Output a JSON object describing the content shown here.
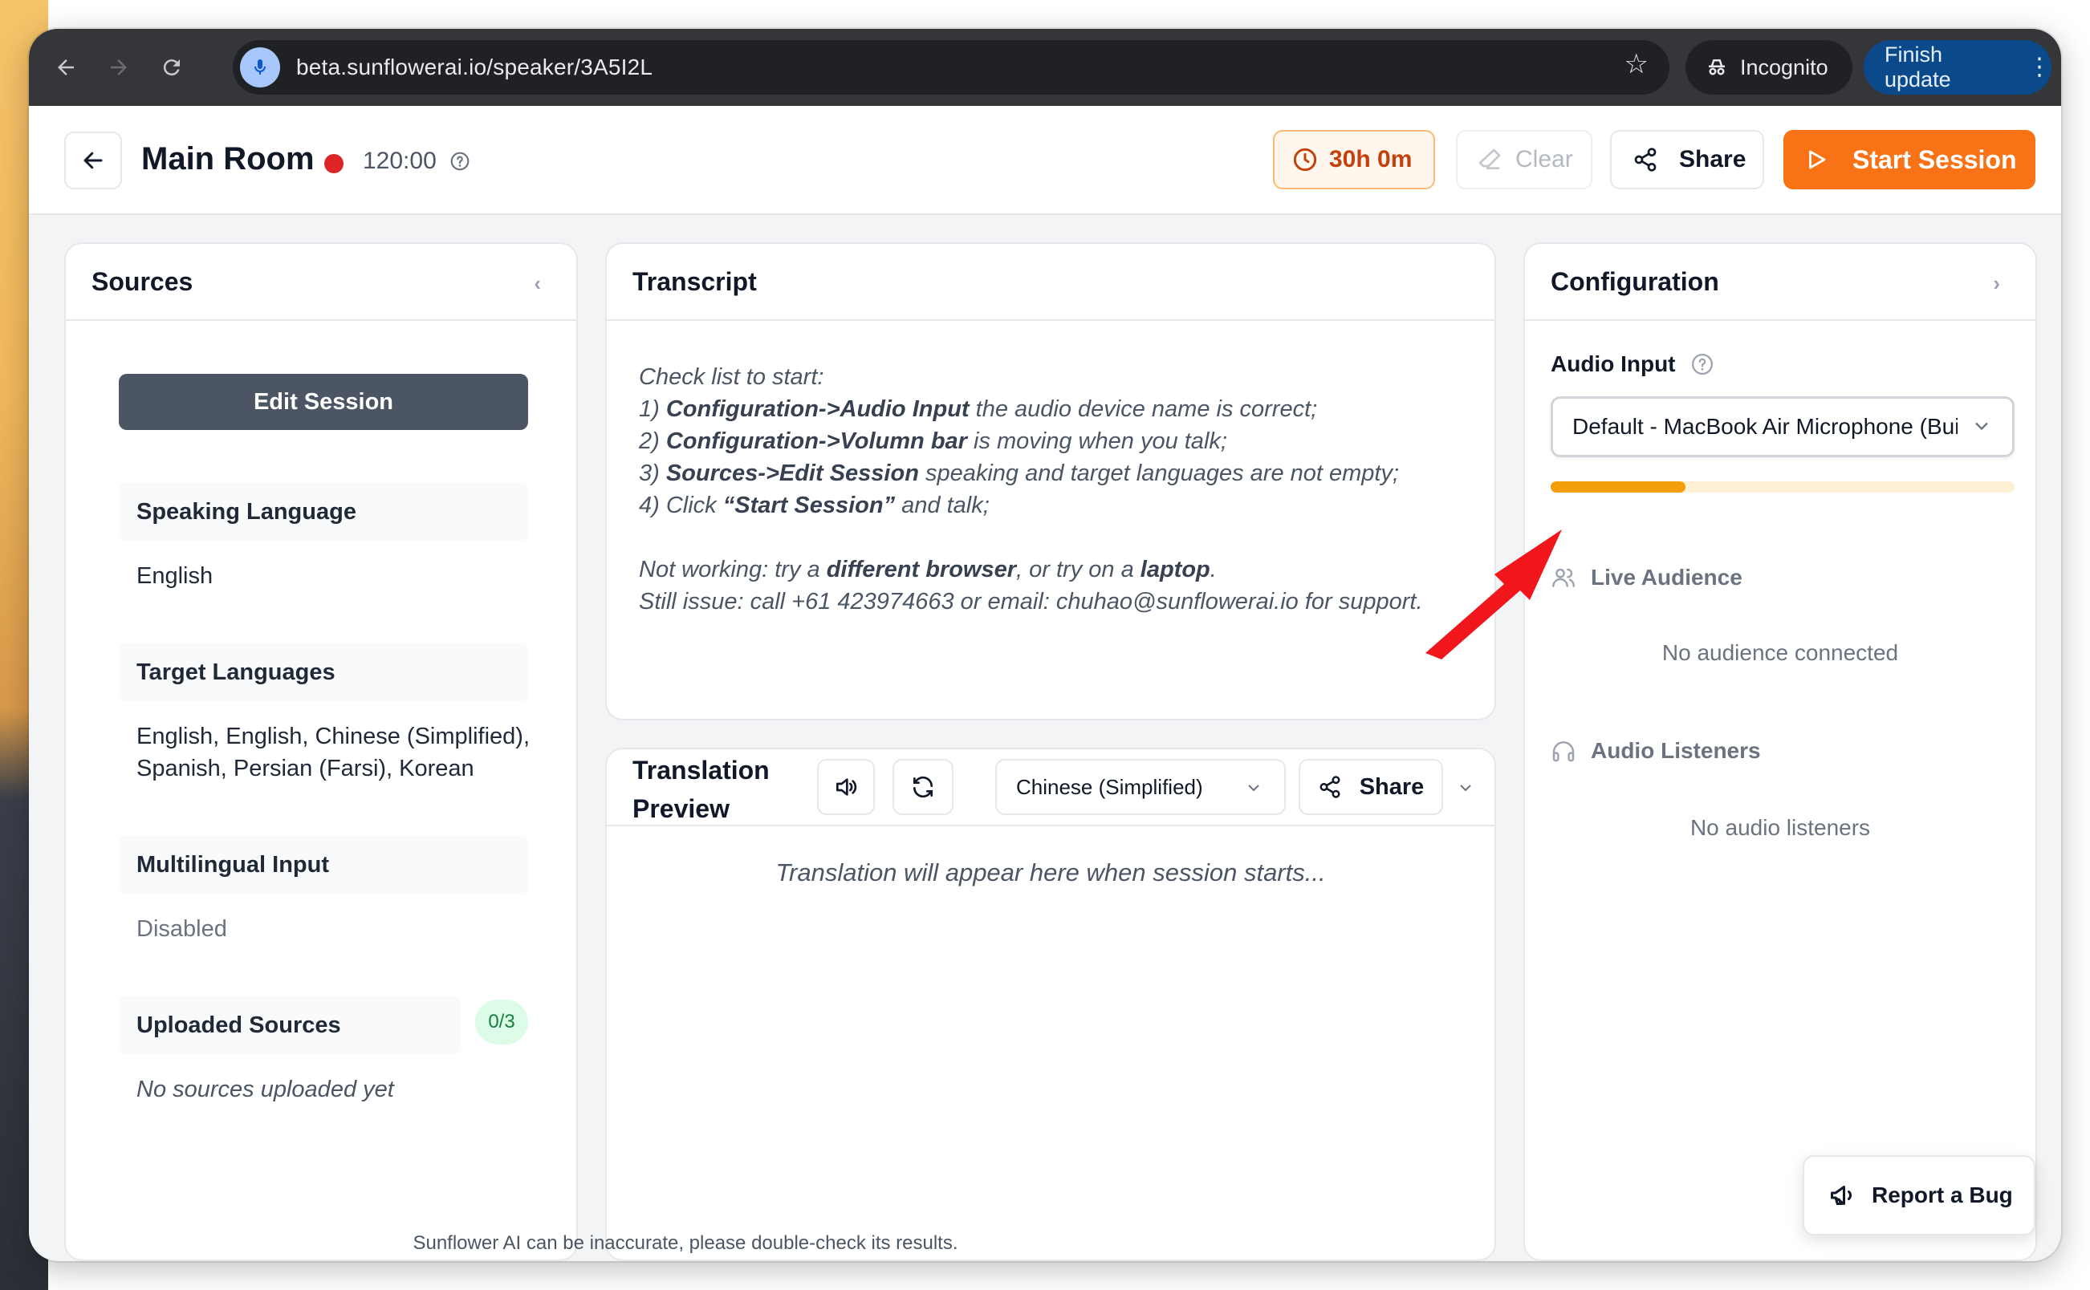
{
  "browser": {
    "url": "beta.sunflowerai.io/speaker/3A5I2L",
    "incognito_label": "Incognito",
    "finish_update_label": "Finish update"
  },
  "header": {
    "room_title": "Main Room",
    "timer": "120:00",
    "quota": "30h 0m",
    "clear_label": "Clear",
    "share_label": "Share",
    "start_label": "Start Session"
  },
  "sources": {
    "title": "Sources",
    "edit_session_label": "Edit Session",
    "speaking_language_label": "Speaking Language",
    "speaking_language_value": "English",
    "target_languages_label": "Target Languages",
    "target_languages_value_line1": "English, English, Chinese (Simplified),",
    "target_languages_value_line2": "Spanish, Persian (Farsi), Korean",
    "multilingual_label": "Multilingual Input",
    "multilingual_value": "Disabled",
    "uploaded_label": "Uploaded Sources",
    "uploaded_count": "0/3",
    "uploaded_empty": "No sources uploaded yet"
  },
  "transcript": {
    "title": "Transcript",
    "intro": "Check list to start:",
    "step1_prefix": "1) ",
    "step1_bold": "Configuration->Audio Input",
    "step1_rest": " the audio device name is correct;",
    "step2_prefix": "2) ",
    "step2_bold": "Configuration->Volumn bar",
    "step2_rest": " is moving when you talk;",
    "step3_prefix": "3) ",
    "step3_bold": "Sources->Edit Session",
    "step3_rest": " speaking and target languages are not empty;",
    "step4_prefix": "4) Click ",
    "step4_bold": "“Start Session”",
    "step4_rest": " and talk;",
    "notworking_a": "Not working: try a ",
    "notworking_b1": "different browser",
    "notworking_c": ", or try on a ",
    "notworking_b2": "laptop",
    "notworking_d": ".",
    "still_issue": "Still issue: call +61 423974663 or email: chuhao@sunflowerai.io for support."
  },
  "translation": {
    "title_line1": "Translation",
    "title_line2": "Preview",
    "language": "Chinese (Simplified)",
    "share_label": "Share",
    "placeholder": "Translation will appear here when session starts..."
  },
  "config": {
    "title": "Configuration",
    "audio_input_label": "Audio Input",
    "device": "Default - MacBook Air Microphone (Built-in)",
    "volume_level": 0.29,
    "live_audience_label": "Live Audience",
    "live_audience_empty": "No audience connected",
    "audio_listeners_label": "Audio Listeners",
    "audio_listeners_empty": "No audio listeners"
  },
  "report_bug_label": "Report a Bug",
  "footer": "Sunflower AI can be inaccurate, please double-check its results.",
  "colors": {
    "accent": "#f97316",
    "record": "#dc2626",
    "volume": "#f59e0b",
    "annotation_arrow": "#f0161c"
  }
}
